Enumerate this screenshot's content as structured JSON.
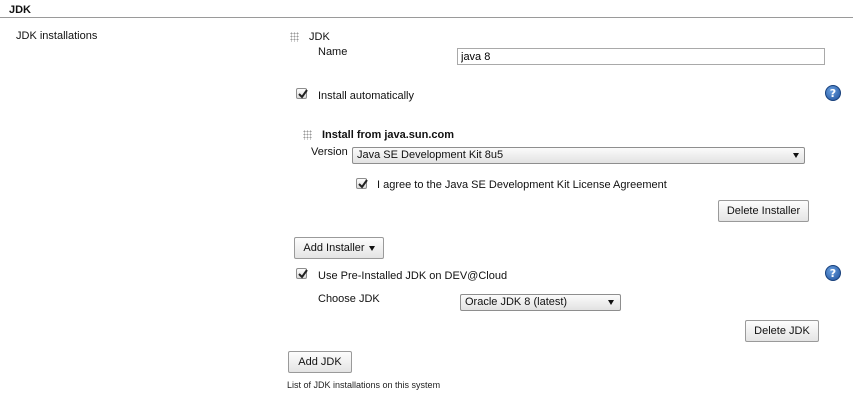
{
  "section": {
    "title": "JDK",
    "installations_label": "JDK installations",
    "description": "List of JDK installations on this system"
  },
  "jdk": {
    "header": "JDK",
    "name_label": "Name",
    "name_value": "java 8",
    "install_auto_label": "Install automatically",
    "install_auto_checked": true,
    "installer": {
      "header": "Install from java.sun.com",
      "version_label": "Version",
      "version_selected": "Java SE Development Kit 8u5",
      "license_label": "I agree to the Java SE Development Kit License Agreement",
      "license_checked": true,
      "delete_label": "Delete Installer"
    },
    "add_installer_label": "Add Installer",
    "preinstalled_label": "Use Pre-Installed JDK on DEV@Cloud",
    "preinstalled_checked": true,
    "choose_jdk_label": "Choose JDK",
    "choose_jdk_selected": "Oracle JDK 8 (latest)",
    "delete_jdk_label": "Delete JDK",
    "help_icon_text": "?"
  },
  "add_jdk_label": "Add JDK",
  "colors": {
    "help_icon": "#1d4f9a",
    "rule": "#9a9a9a"
  }
}
